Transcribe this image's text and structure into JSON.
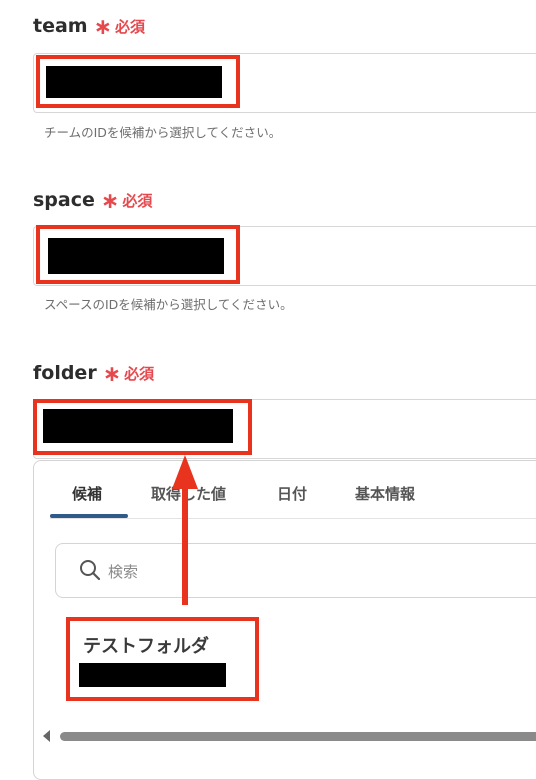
{
  "fields": [
    {
      "label": "team",
      "required_mark": "∗",
      "required_text": "必須",
      "help": "チームのIDを候補から選択してください。"
    },
    {
      "label": "space",
      "required_mark": "∗",
      "required_text": "必須",
      "help": "スペースのIDを候補から選択してください。"
    },
    {
      "label": "folder",
      "required_mark": "∗",
      "required_text": "必須"
    }
  ],
  "picker": {
    "tabs": [
      "候補",
      "取得した値",
      "日付",
      "基本情報"
    ],
    "active_tab": "候補",
    "search_placeholder": "検索",
    "search_icon": "search-icon",
    "options": [
      {
        "title": "テストフォルダ"
      }
    ]
  },
  "colors": {
    "highlight": "#e8341f",
    "required": "#e5484d",
    "active_tab": "#2f5a8a"
  }
}
